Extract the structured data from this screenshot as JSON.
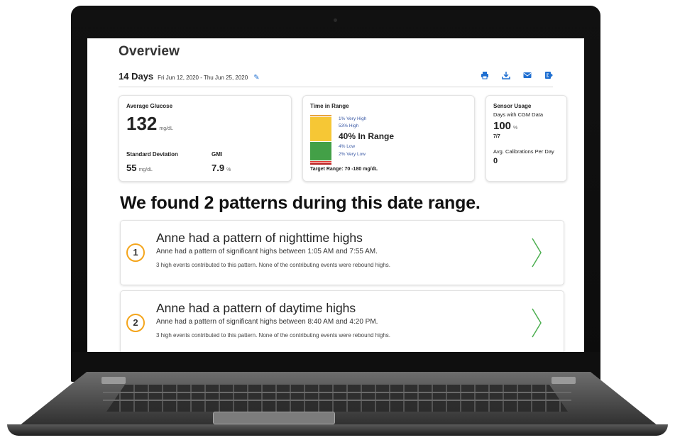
{
  "overview": {
    "title": "Overview",
    "days": "14 Days",
    "date_range": "Fri Jun 12, 2020 - Thu Jun 25, 2020",
    "tools": [
      "print-icon",
      "download-icon",
      "email-icon",
      "export-icon"
    ]
  },
  "glucose_card": {
    "avg_label": "Average Glucose",
    "avg_value": "132",
    "avg_unit": "mg/dL",
    "sd_label": "Standard Deviation",
    "sd_value": "55",
    "sd_unit": "mg/dL",
    "gmi_label": "GMI",
    "gmi_value": "7.9",
    "gmi_unit": "%"
  },
  "tir_card": {
    "label": "Time in Range",
    "very_high": "1% Very High",
    "high": "53% High",
    "in_range": "40% In Range",
    "low": "4% Low",
    "very_low": "2% Very Low",
    "target": "Target Range: 70 -180 mg/dL",
    "colors": {
      "very_high": "#e8a33a",
      "high": "#f6c735",
      "in_range": "#43a047",
      "low": "#e53935",
      "very_low": "#b71c1c"
    },
    "fractions": {
      "very_high": 0.01,
      "high": 0.53,
      "in_range": 0.4,
      "low": 0.04,
      "very_low": 0.02
    }
  },
  "sensor_card": {
    "label": "Sensor Usage",
    "days_label": "Days with CGM Data",
    "days_value": "100",
    "days_unit": "%",
    "days_ratio": "7/7",
    "calib_label": "Avg. Calibrations Per Day",
    "calib_value": "0"
  },
  "patterns": {
    "headline": "We found 2 patterns during this date range.",
    "items": [
      {
        "number": "1",
        "title": "Anne had a pattern of nighttime highs",
        "subtitle": "Anne had a pattern of significant highs between 1:05 AM and 7:55 AM.",
        "note": "3 high events contributed to this pattern. None of the contributing events were rebound highs."
      },
      {
        "number": "2",
        "title": "Anne had a pattern of daytime highs",
        "subtitle": "Anne had a pattern of significant highs between 8:40 AM and 4:20 PM.",
        "note": "3 high events contributed to this pattern. None of the contributing events were rebound highs."
      }
    ]
  },
  "accent": "#1f6fd1",
  "badge_color": "#f4a51c",
  "chevron_color": "#4caf50"
}
